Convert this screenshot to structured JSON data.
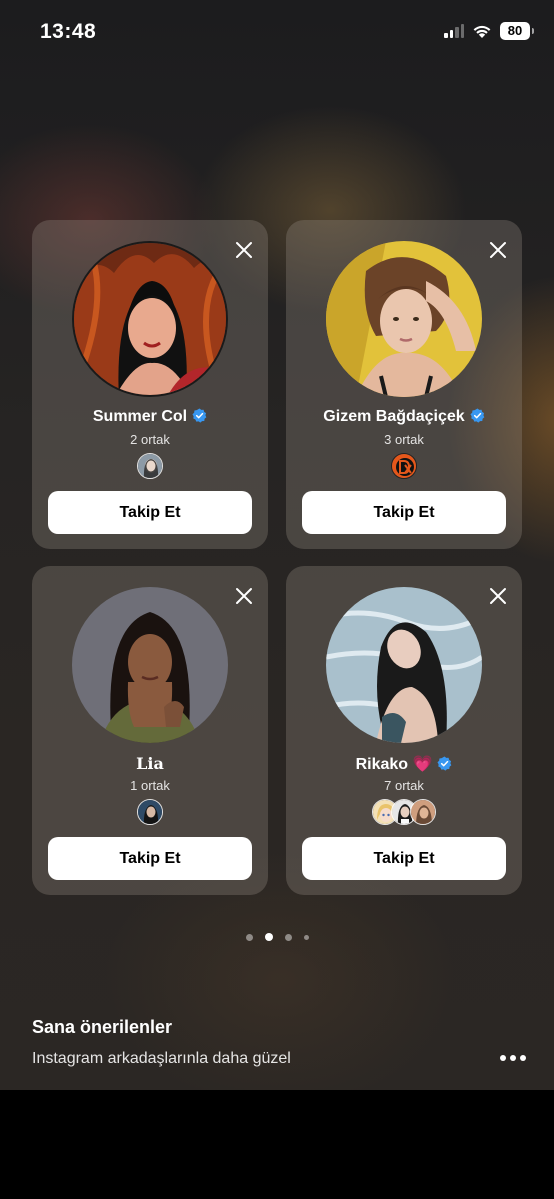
{
  "status_bar": {
    "time": "13:48",
    "battery": "80"
  },
  "cards": [
    {
      "name": "Summer Col",
      "verified": true,
      "mutual": "2 ortak",
      "follow_label": "Takip Et"
    },
    {
      "name": "Gizem Bağdaçiçek",
      "verified": true,
      "mutual": "3 ortak",
      "follow_label": "Takip Et"
    },
    {
      "name": "Lia",
      "verified": false,
      "mutual": "1 ortak",
      "follow_label": "Takip Et"
    },
    {
      "name": "Rikako 💗",
      "verified": true,
      "mutual": "7 ortak",
      "follow_label": "Takip Et"
    }
  ],
  "pager": {
    "pages": 4,
    "active_index": 1
  },
  "section": {
    "title": "Sana önerilenler",
    "subtitle": "Instagram arkadaşlarınla daha güzel"
  },
  "colors": {
    "verified_badge": "#3897f0",
    "follow_button_bg": "#ffffff"
  }
}
